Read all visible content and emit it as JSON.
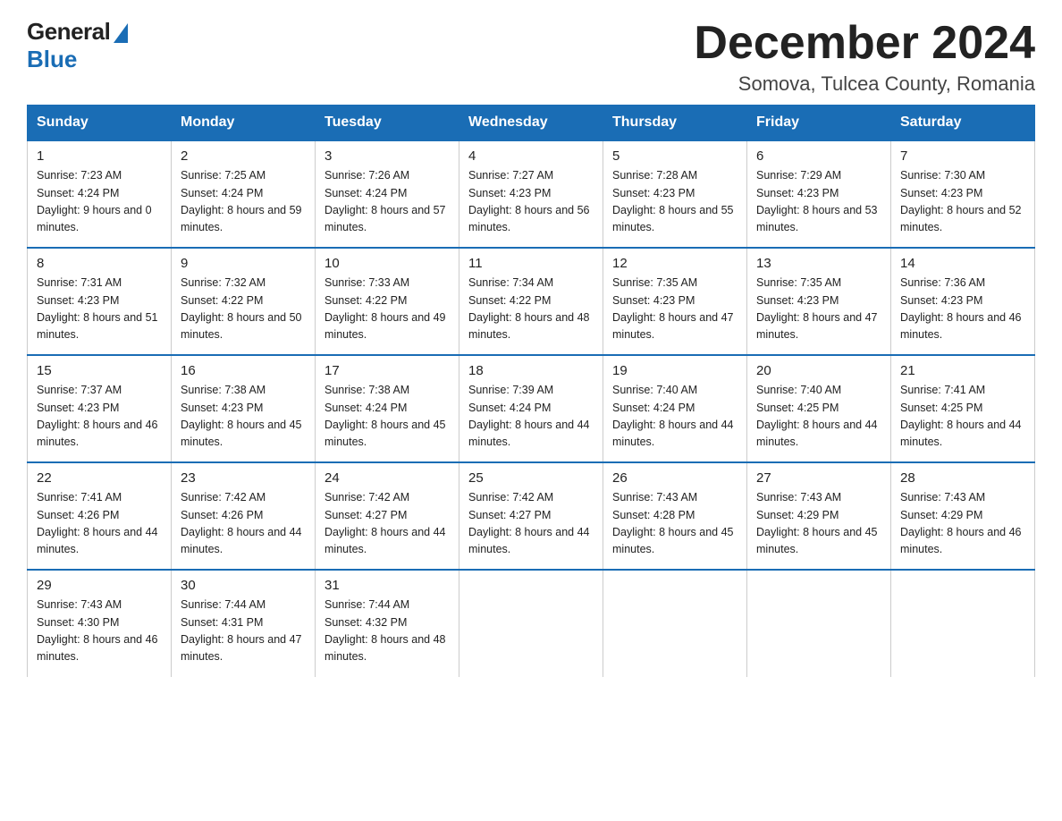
{
  "header": {
    "logo_general": "General",
    "logo_blue": "Blue",
    "month_year": "December 2024",
    "location": "Somova, Tulcea County, Romania"
  },
  "days_of_week": [
    "Sunday",
    "Monday",
    "Tuesday",
    "Wednesday",
    "Thursday",
    "Friday",
    "Saturday"
  ],
  "weeks": [
    [
      {
        "day": "1",
        "sunrise": "7:23 AM",
        "sunset": "4:24 PM",
        "daylight": "9 hours and 0 minutes."
      },
      {
        "day": "2",
        "sunrise": "7:25 AM",
        "sunset": "4:24 PM",
        "daylight": "8 hours and 59 minutes."
      },
      {
        "day": "3",
        "sunrise": "7:26 AM",
        "sunset": "4:24 PM",
        "daylight": "8 hours and 57 minutes."
      },
      {
        "day": "4",
        "sunrise": "7:27 AM",
        "sunset": "4:23 PM",
        "daylight": "8 hours and 56 minutes."
      },
      {
        "day": "5",
        "sunrise": "7:28 AM",
        "sunset": "4:23 PM",
        "daylight": "8 hours and 55 minutes."
      },
      {
        "day": "6",
        "sunrise": "7:29 AM",
        "sunset": "4:23 PM",
        "daylight": "8 hours and 53 minutes."
      },
      {
        "day": "7",
        "sunrise": "7:30 AM",
        "sunset": "4:23 PM",
        "daylight": "8 hours and 52 minutes."
      }
    ],
    [
      {
        "day": "8",
        "sunrise": "7:31 AM",
        "sunset": "4:23 PM",
        "daylight": "8 hours and 51 minutes."
      },
      {
        "day": "9",
        "sunrise": "7:32 AM",
        "sunset": "4:22 PM",
        "daylight": "8 hours and 50 minutes."
      },
      {
        "day": "10",
        "sunrise": "7:33 AM",
        "sunset": "4:22 PM",
        "daylight": "8 hours and 49 minutes."
      },
      {
        "day": "11",
        "sunrise": "7:34 AM",
        "sunset": "4:22 PM",
        "daylight": "8 hours and 48 minutes."
      },
      {
        "day": "12",
        "sunrise": "7:35 AM",
        "sunset": "4:23 PM",
        "daylight": "8 hours and 47 minutes."
      },
      {
        "day": "13",
        "sunrise": "7:35 AM",
        "sunset": "4:23 PM",
        "daylight": "8 hours and 47 minutes."
      },
      {
        "day": "14",
        "sunrise": "7:36 AM",
        "sunset": "4:23 PM",
        "daylight": "8 hours and 46 minutes."
      }
    ],
    [
      {
        "day": "15",
        "sunrise": "7:37 AM",
        "sunset": "4:23 PM",
        "daylight": "8 hours and 46 minutes."
      },
      {
        "day": "16",
        "sunrise": "7:38 AM",
        "sunset": "4:23 PM",
        "daylight": "8 hours and 45 minutes."
      },
      {
        "day": "17",
        "sunrise": "7:38 AM",
        "sunset": "4:24 PM",
        "daylight": "8 hours and 45 minutes."
      },
      {
        "day": "18",
        "sunrise": "7:39 AM",
        "sunset": "4:24 PM",
        "daylight": "8 hours and 44 minutes."
      },
      {
        "day": "19",
        "sunrise": "7:40 AM",
        "sunset": "4:24 PM",
        "daylight": "8 hours and 44 minutes."
      },
      {
        "day": "20",
        "sunrise": "7:40 AM",
        "sunset": "4:25 PM",
        "daylight": "8 hours and 44 minutes."
      },
      {
        "day": "21",
        "sunrise": "7:41 AM",
        "sunset": "4:25 PM",
        "daylight": "8 hours and 44 minutes."
      }
    ],
    [
      {
        "day": "22",
        "sunrise": "7:41 AM",
        "sunset": "4:26 PM",
        "daylight": "8 hours and 44 minutes."
      },
      {
        "day": "23",
        "sunrise": "7:42 AM",
        "sunset": "4:26 PM",
        "daylight": "8 hours and 44 minutes."
      },
      {
        "day": "24",
        "sunrise": "7:42 AM",
        "sunset": "4:27 PM",
        "daylight": "8 hours and 44 minutes."
      },
      {
        "day": "25",
        "sunrise": "7:42 AM",
        "sunset": "4:27 PM",
        "daylight": "8 hours and 44 minutes."
      },
      {
        "day": "26",
        "sunrise": "7:43 AM",
        "sunset": "4:28 PM",
        "daylight": "8 hours and 45 minutes."
      },
      {
        "day": "27",
        "sunrise": "7:43 AM",
        "sunset": "4:29 PM",
        "daylight": "8 hours and 45 minutes."
      },
      {
        "day": "28",
        "sunrise": "7:43 AM",
        "sunset": "4:29 PM",
        "daylight": "8 hours and 46 minutes."
      }
    ],
    [
      {
        "day": "29",
        "sunrise": "7:43 AM",
        "sunset": "4:30 PM",
        "daylight": "8 hours and 46 minutes."
      },
      {
        "day": "30",
        "sunrise": "7:44 AM",
        "sunset": "4:31 PM",
        "daylight": "8 hours and 47 minutes."
      },
      {
        "day": "31",
        "sunrise": "7:44 AM",
        "sunset": "4:32 PM",
        "daylight": "8 hours and 48 minutes."
      },
      null,
      null,
      null,
      null
    ]
  ]
}
